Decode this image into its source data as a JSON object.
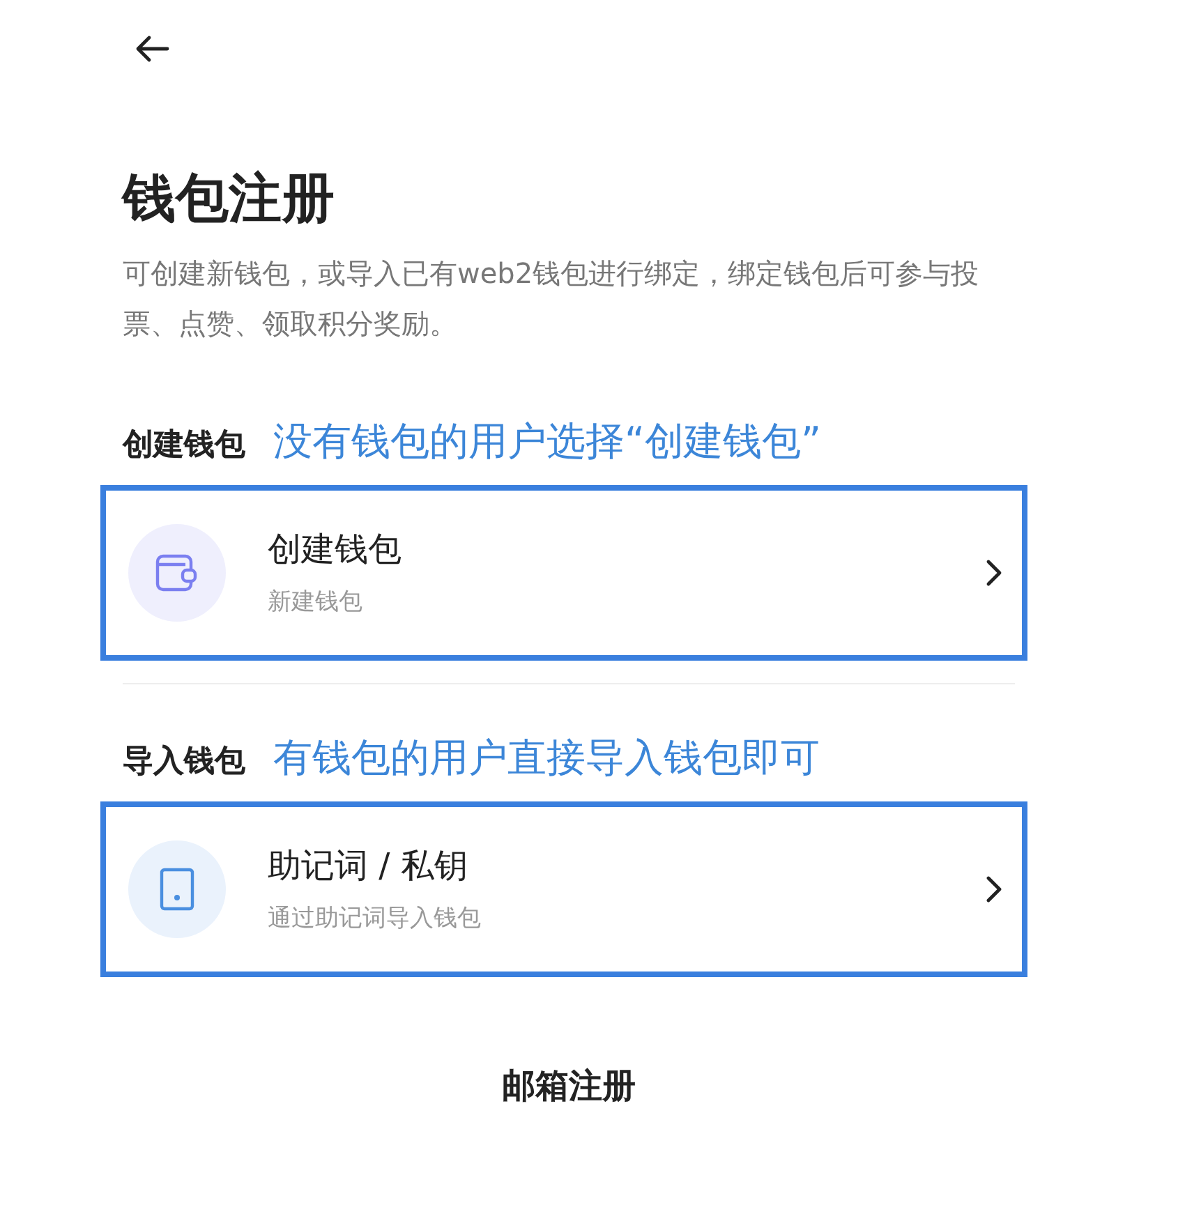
{
  "title": "钱包注册",
  "description": "可创建新钱包，或导入已有web2钱包进行绑定，绑定钱包后可参与投票、点赞、领取积分奖励。",
  "sections": [
    {
      "heading": "创建钱包",
      "note": "没有钱包的用户选择“创建钱包”",
      "options": [
        {
          "kind": "wallet",
          "title": "创建钱包",
          "subtitle": "新建钱包",
          "annotated": true
        }
      ]
    },
    {
      "heading": "导入钱包",
      "note": "有钱包的用户直接导入钱包即可",
      "options": [
        {
          "kind": "phrase",
          "title": "助记词 / 私钥",
          "subtitle": "通过助记词导入钱包",
          "annotated": true
        }
      ]
    }
  ],
  "footer_link": "邮箱注册"
}
